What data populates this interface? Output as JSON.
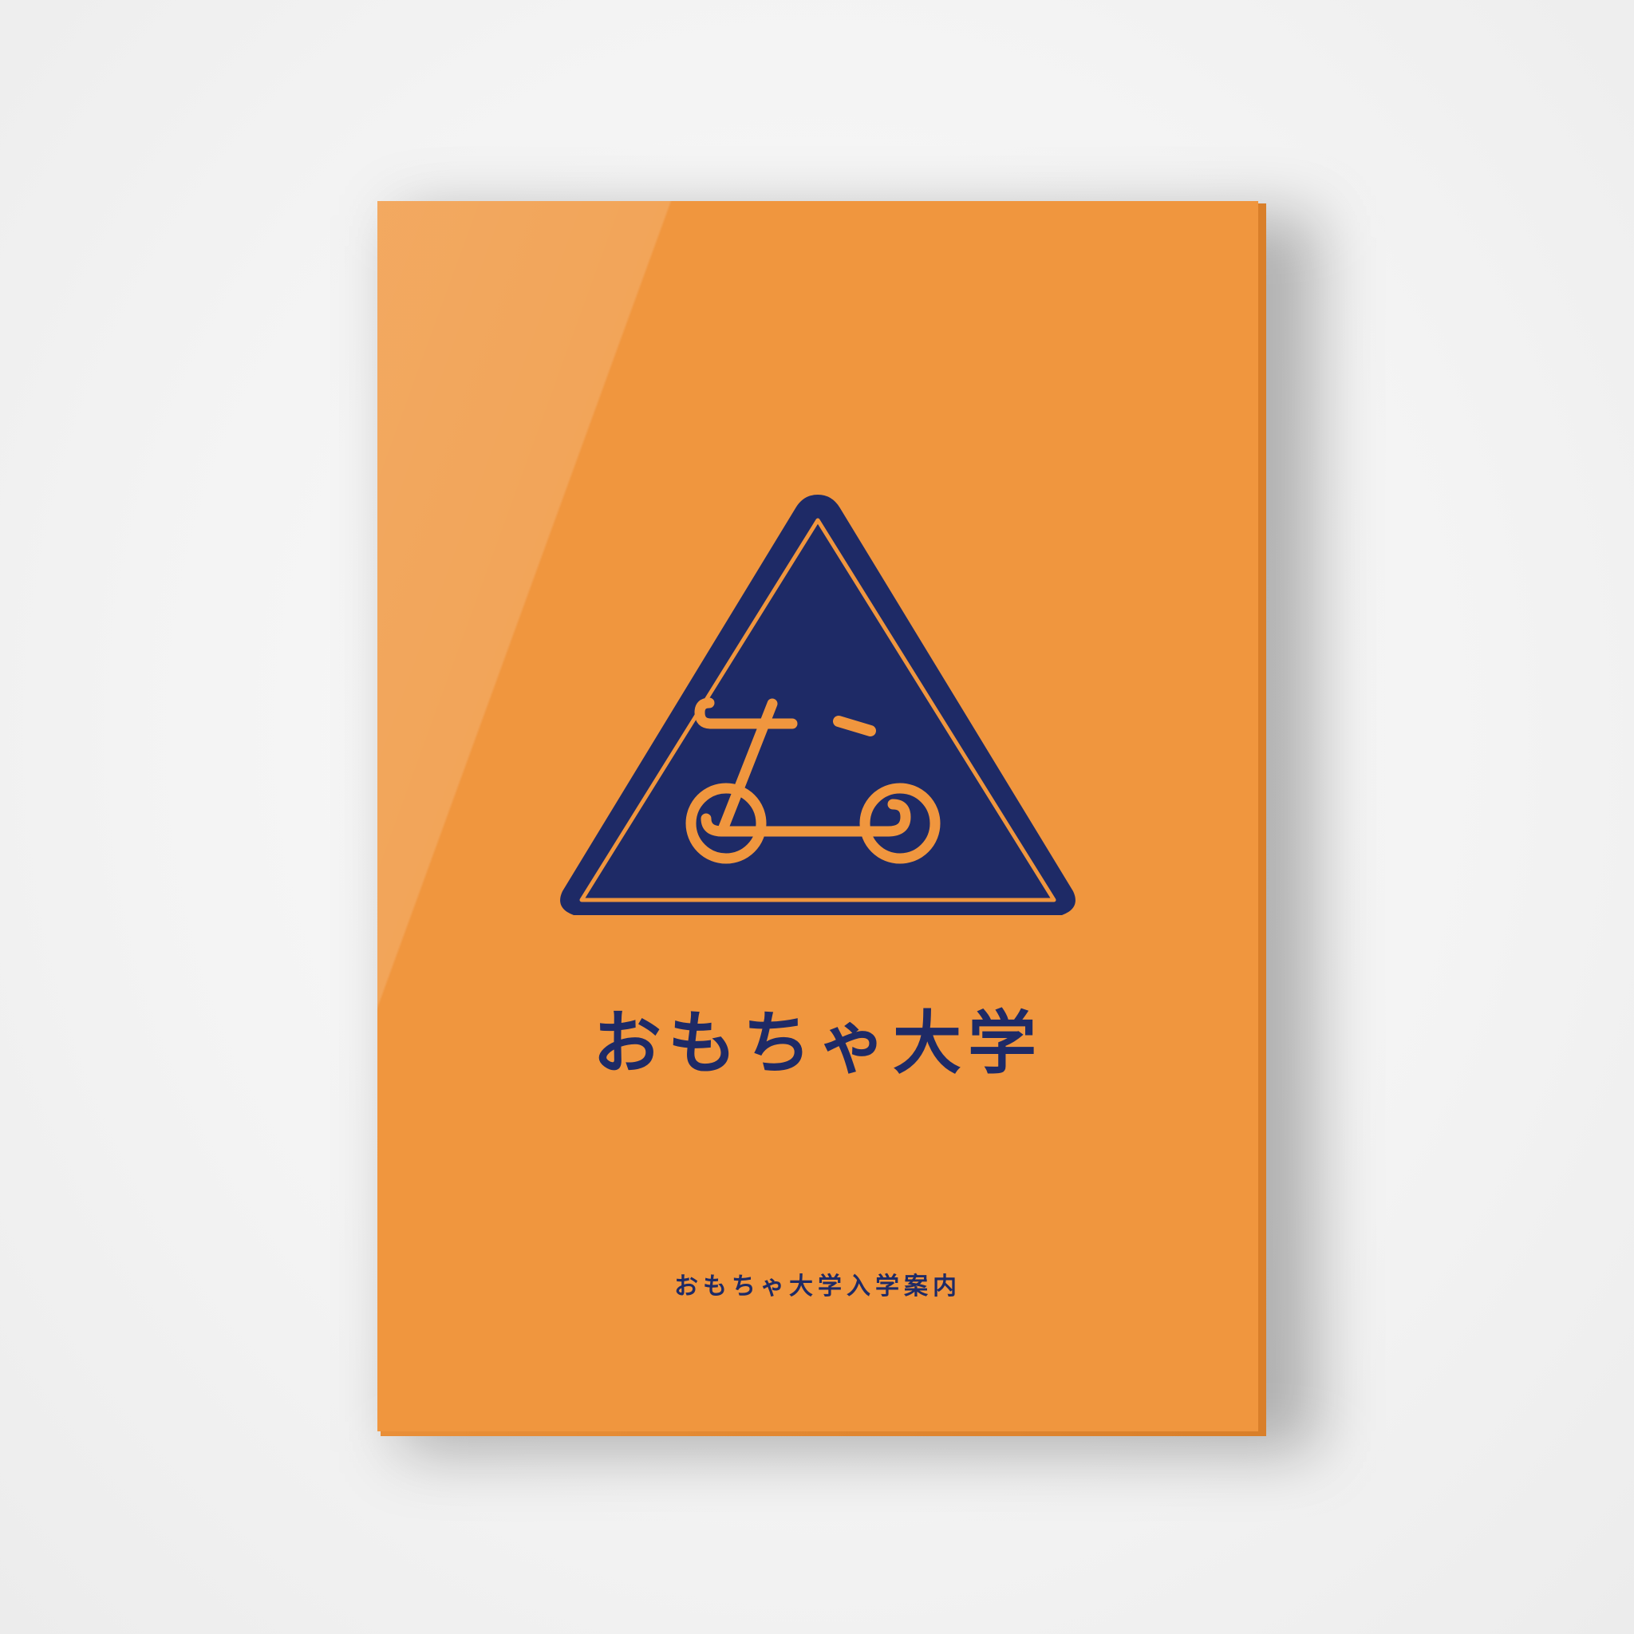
{
  "cover": {
    "logo_text": "おもちゃ大学",
    "subtitle": "おもちゃ大学入学案内",
    "icon": "bicycle-warning-sign-icon"
  },
  "colors": {
    "background": "#f4f4f4",
    "cover_orange": "#f0963e",
    "navy": "#1e2a66"
  }
}
